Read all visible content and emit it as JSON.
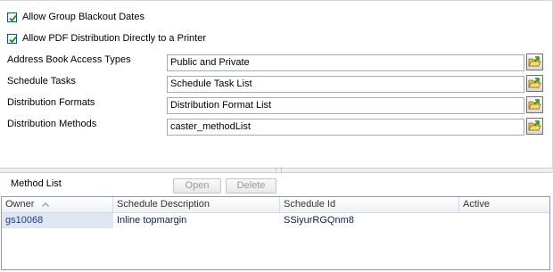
{
  "options": {
    "blackout": {
      "label": "Allow Group Blackout Dates",
      "checked": true
    },
    "pdf_printer": {
      "label": "Allow PDF Distribution Directly to a Printer",
      "checked": true
    }
  },
  "fields": [
    {
      "label": "Address Book Access Types",
      "value": "Public and Private",
      "icon": "folder-open-icon"
    },
    {
      "label": "Schedule Tasks",
      "value": "Schedule Task List",
      "icon": "folder-open-icon"
    },
    {
      "label": "Distribution Formats",
      "value": "Distribution Format List",
      "icon": "folder-open-icon"
    },
    {
      "label": "Distribution Methods",
      "value": "caster_methodList",
      "icon": "folder-open-icon"
    }
  ],
  "method_list": {
    "title": "Method List",
    "open_label": "Open",
    "delete_label": "Delete",
    "columns": [
      "Owner",
      "Schedule Description",
      "Schedule Id",
      "Active"
    ],
    "sort": {
      "column": "Owner",
      "icon": "sort-ascending-icon"
    },
    "rows": [
      {
        "owner": "gs10068",
        "description": "Inline topmargin",
        "schedule_id": "SSiyurRGQnm8",
        "active": ""
      }
    ]
  },
  "colors": {
    "selected_cell": "#dfe6f2",
    "grid_border": "#8e9bb0",
    "checkbox_border": "#1c5180",
    "check_mark": "#2a8a2a"
  }
}
